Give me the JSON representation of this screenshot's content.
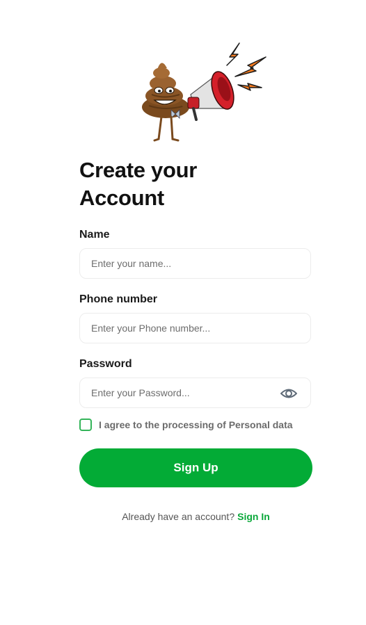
{
  "header": {
    "illustration_icon": "poop-megaphone-icon",
    "title_line1": "Create your",
    "title_line2": "Account"
  },
  "form": {
    "name": {
      "label": "Name",
      "value": "",
      "placeholder": "Enter your name..."
    },
    "phone": {
      "label": "Phone number",
      "value": "",
      "placeholder": "Enter your Phone number..."
    },
    "password": {
      "label": "Password",
      "value": "",
      "placeholder": "Enter your Password...",
      "toggle_icon": "eye-icon"
    },
    "agree": {
      "checked": false,
      "label": "I agree to the processing of Personal data"
    },
    "submit_label": "Sign Up"
  },
  "footer": {
    "question": "Already have an account?",
    "link_label": "Sign In"
  },
  "colors": {
    "primary": "#03ab36",
    "link": "#0aa83a",
    "checkbox_border": "#34b45a",
    "input_border": "#ececec",
    "title": "#111111"
  }
}
